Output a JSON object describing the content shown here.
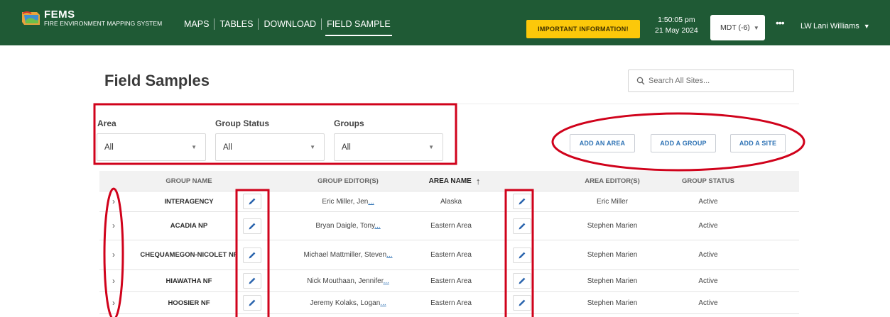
{
  "colors": {
    "header_bg": "#1f5a35",
    "important_bg": "#fcc80a",
    "link_blue": "#2f73b5",
    "annotation_red": "#d0021b"
  },
  "header": {
    "logo_title": "FEMS",
    "logo_subtitle": "FIRE ENVIRONMENT MAPPING SYSTEM",
    "nav": [
      {
        "label": "MAPS"
      },
      {
        "label": "TABLES"
      },
      {
        "label": "DOWNLOAD"
      },
      {
        "label": "FIELD SAMPLE"
      }
    ],
    "important_label": "IMPORTANT INFORMATION!",
    "time": "1:50:05 pm",
    "date": "21 May 2024",
    "timezone": "MDT (-6)",
    "user_initials": "LW",
    "user_name": "Lani Williams"
  },
  "page": {
    "title": "Field Samples",
    "search_placeholder": "Search All Sites..."
  },
  "filters": [
    {
      "label": "Area",
      "value": "All"
    },
    {
      "label": "Group Status",
      "value": "All"
    },
    {
      "label": "Groups",
      "value": "All"
    }
  ],
  "actions": [
    {
      "label": "ADD AN AREA"
    },
    {
      "label": "ADD A GROUP"
    },
    {
      "label": "ADD A SITE"
    }
  ],
  "table": {
    "columns": {
      "group_name": "GROUP NAME",
      "group_editors": "GROUP EDITOR(S)",
      "area_name": "AREA NAME",
      "area_editors": "AREA EDITOR(S)",
      "group_status": "GROUP STATUS"
    },
    "more_link": "...",
    "rows": [
      {
        "group": "INTERAGENCY",
        "editors": "Eric Miller, Jen",
        "area": "Alaska",
        "area_editors": "Eric Miller",
        "status": "Active"
      },
      {
        "group": "ACADIA NP",
        "editors": "Bryan Daigle, Tony",
        "area": "Eastern Area",
        "area_editors": "Stephen Marien",
        "status": "Active"
      },
      {
        "group": "CHEQUAMEGON-NICOLET NF",
        "editors": "Michael Mattmiller, Steven",
        "area": "Eastern Area",
        "area_editors": "Stephen Marien",
        "status": "Active"
      },
      {
        "group": "HIAWATHA NF",
        "editors": "Nick Mouthaan, Jennifer",
        "area": "Eastern Area",
        "area_editors": "Stephen Marien",
        "status": "Active"
      },
      {
        "group": "HOOSIER NF",
        "editors": "Jeremy Kolaks, Logan",
        "area": "Eastern Area",
        "area_editors": "Stephen Marien",
        "status": "Active"
      }
    ]
  }
}
